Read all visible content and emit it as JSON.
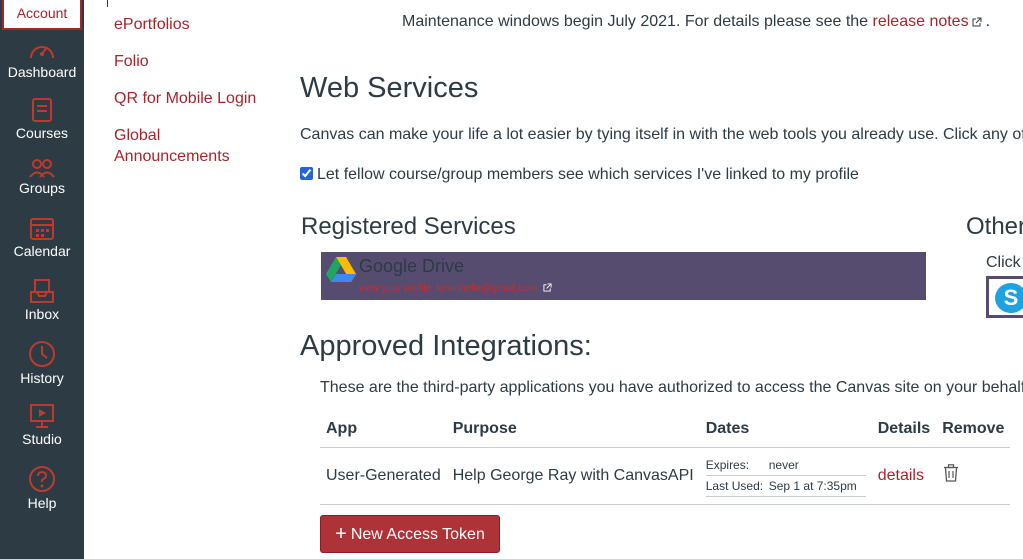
{
  "global_nav": {
    "account": "Account",
    "items": [
      {
        "label": "Dashboard",
        "icon": "dashboard-icon"
      },
      {
        "label": "Courses",
        "icon": "courses-icon"
      },
      {
        "label": "Groups",
        "icon": "groups-icon"
      },
      {
        "label": "Calendar",
        "icon": "calendar-icon"
      },
      {
        "label": "Inbox",
        "icon": "inbox-icon"
      },
      {
        "label": "History",
        "icon": "history-icon"
      },
      {
        "label": "Studio",
        "icon": "studio-icon"
      },
      {
        "label": "Help",
        "icon": "help-icon"
      }
    ]
  },
  "sub_nav": {
    "items": [
      "ePortfolios",
      "Folio",
      "QR for Mobile Login",
      "Global",
      "Announcements"
    ]
  },
  "notice": {
    "text": "Maintenance windows begin July 2021. For details please see the ",
    "link": "release notes",
    "suffix": "."
  },
  "web_services": {
    "title": "Web Services",
    "intro": "Canvas can make your life a lot easier by tying itself in with the web tools you already use. Click any of the",
    "checkbox_label": "Let fellow course/group members see which services I've linked to my profile",
    "checkbox_checked": true,
    "registered_title": "Registered Services",
    "other_title": "Other",
    "click_text": "Click",
    "service_name": "Google Drive",
    "service_link": "view your profile: kevinbelle@gmail.com"
  },
  "approved": {
    "title": "Approved Integrations:",
    "description": "These are the third-party applications you have authorized to access the Canvas site on your behalf:",
    "columns": [
      "App",
      "Purpose",
      "Dates",
      "Details",
      "Remove"
    ],
    "rows": [
      {
        "app": "User-Generated",
        "purpose": "Help George Ray with CanvasAPI",
        "expires_label": "Expires:",
        "expires_value": "never",
        "last_used_label": "Last Used:",
        "last_used_value": "Sep 1 at 7:35pm",
        "details": "details"
      }
    ],
    "new_token_button": "New Access Token"
  },
  "colors": {
    "nav_bg": "#2d3b45",
    "brand": "#a5252c",
    "button": "#ae3338",
    "service_card": "#564c70"
  }
}
